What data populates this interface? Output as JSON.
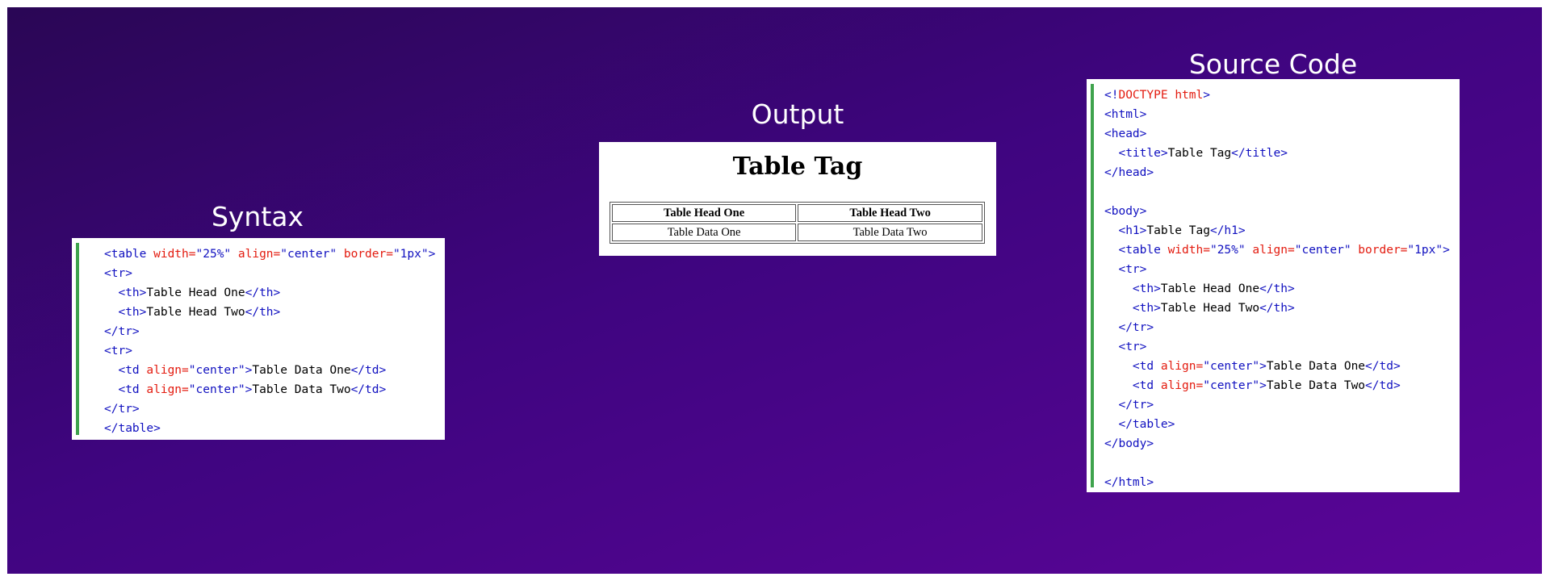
{
  "panels": {
    "syntax_title": "Syntax",
    "output_title": "Output",
    "source_title": "Source Code"
  },
  "output": {
    "heading": "Table Tag",
    "headers": [
      "Table Head One",
      "Table Head Two"
    ],
    "row": [
      "Table Data One",
      "Table Data Two"
    ]
  },
  "syntax_code": [
    [
      [
        "t",
        "<table "
      ],
      [
        "a",
        "width="
      ],
      [
        "v",
        "\"25%\""
      ],
      [
        "a",
        " align="
      ],
      [
        "v",
        "\"center\""
      ],
      [
        "a",
        " border="
      ],
      [
        "v",
        "\"1px\""
      ],
      [
        "t",
        ">"
      ]
    ],
    [
      [
        "t",
        "<tr>"
      ]
    ],
    [
      [
        "x",
        "  "
      ],
      [
        "t",
        "<th>"
      ],
      [
        "x",
        "Table Head One"
      ],
      [
        "t",
        "</th>"
      ]
    ],
    [
      [
        "x",
        "  "
      ],
      [
        "t",
        "<th>"
      ],
      [
        "x",
        "Table Head Two"
      ],
      [
        "t",
        "</th>"
      ]
    ],
    [
      [
        "t",
        "</tr>"
      ]
    ],
    [
      [
        "t",
        "<tr>"
      ]
    ],
    [
      [
        "x",
        "  "
      ],
      [
        "t",
        "<td "
      ],
      [
        "a",
        "align="
      ],
      [
        "v",
        "\"center\""
      ],
      [
        "t",
        ">"
      ],
      [
        "x",
        "Table Data One"
      ],
      [
        "t",
        "</td>"
      ]
    ],
    [
      [
        "x",
        "  "
      ],
      [
        "t",
        "<td "
      ],
      [
        "a",
        "align="
      ],
      [
        "v",
        "\"center\""
      ],
      [
        "t",
        ">"
      ],
      [
        "x",
        "Table Data Two"
      ],
      [
        "t",
        "</td>"
      ]
    ],
    [
      [
        "t",
        "</tr>"
      ]
    ],
    [
      [
        "t",
        "</table>"
      ]
    ]
  ],
  "source_code": [
    [
      [
        "t",
        "<!"
      ],
      [
        "a",
        "DOCTYPE"
      ],
      [
        "x",
        " "
      ],
      [
        "a",
        "html"
      ],
      [
        "t",
        ">"
      ]
    ],
    [
      [
        "t",
        "<html>"
      ]
    ],
    [
      [
        "t",
        "<head>"
      ]
    ],
    [
      [
        "x",
        "  "
      ],
      [
        "t",
        "<title>"
      ],
      [
        "x",
        "Table Tag"
      ],
      [
        "t",
        "</title>"
      ]
    ],
    [
      [
        "t",
        "</head>"
      ]
    ],
    [],
    [
      [
        "t",
        "<body>"
      ]
    ],
    [
      [
        "x",
        "  "
      ],
      [
        "t",
        "<h1>"
      ],
      [
        "x",
        "Table Tag"
      ],
      [
        "t",
        "</h1>"
      ]
    ],
    [
      [
        "x",
        "  "
      ],
      [
        "t",
        "<table "
      ],
      [
        "a",
        "width="
      ],
      [
        "v",
        "\"25%\""
      ],
      [
        "a",
        " align="
      ],
      [
        "v",
        "\"center\""
      ],
      [
        "a",
        " border="
      ],
      [
        "v",
        "\"1px\""
      ],
      [
        "t",
        ">"
      ]
    ],
    [
      [
        "x",
        "  "
      ],
      [
        "t",
        "<tr>"
      ]
    ],
    [
      [
        "x",
        "    "
      ],
      [
        "t",
        "<th>"
      ],
      [
        "x",
        "Table Head One"
      ],
      [
        "t",
        "</th>"
      ]
    ],
    [
      [
        "x",
        "    "
      ],
      [
        "t",
        "<th>"
      ],
      [
        "x",
        "Table Head Two"
      ],
      [
        "t",
        "</th>"
      ]
    ],
    [
      [
        "x",
        "  "
      ],
      [
        "t",
        "</tr>"
      ]
    ],
    [
      [
        "x",
        "  "
      ],
      [
        "t",
        "<tr>"
      ]
    ],
    [
      [
        "x",
        "    "
      ],
      [
        "t",
        "<td "
      ],
      [
        "a",
        "align="
      ],
      [
        "v",
        "\"center\""
      ],
      [
        "t",
        ">"
      ],
      [
        "x",
        "Table Data One"
      ],
      [
        "t",
        "</td>"
      ]
    ],
    [
      [
        "x",
        "    "
      ],
      [
        "t",
        "<td "
      ],
      [
        "a",
        "align="
      ],
      [
        "v",
        "\"center\""
      ],
      [
        "t",
        ">"
      ],
      [
        "x",
        "Table Data Two"
      ],
      [
        "t",
        "</td>"
      ]
    ],
    [
      [
        "x",
        "  "
      ],
      [
        "t",
        "</tr>"
      ]
    ],
    [
      [
        "x",
        "  "
      ],
      [
        "t",
        "</table>"
      ]
    ],
    [
      [
        "t",
        "</body>"
      ]
    ],
    [],
    [
      [
        "t",
        "</html>"
      ]
    ]
  ]
}
